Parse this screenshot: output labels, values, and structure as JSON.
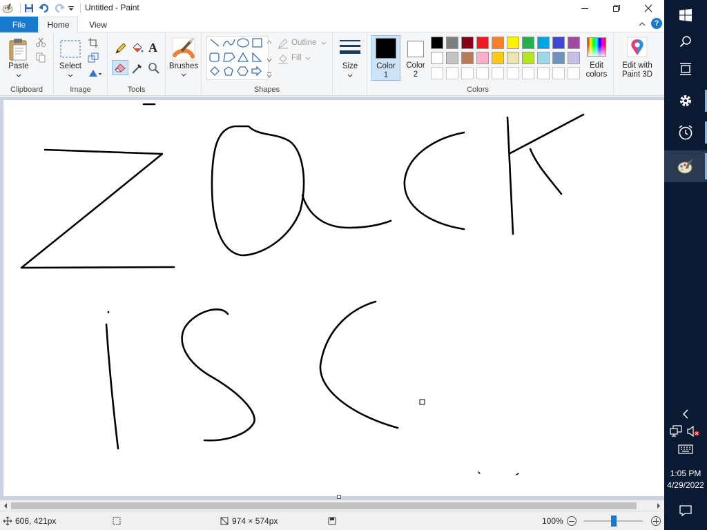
{
  "window": {
    "title": "Untitled - Paint",
    "minimize_icon": "minimize-icon",
    "restore_icon": "restore-icon",
    "close_icon": "close-icon"
  },
  "tabs": {
    "file": "File",
    "home": "Home",
    "view": "View"
  },
  "ribbon": {
    "clipboard": {
      "label": "Clipboard",
      "paste": "Paste"
    },
    "image": {
      "label": "Image",
      "select": "Select"
    },
    "tools": {
      "label": "Tools"
    },
    "brushes": {
      "label": "Brushes"
    },
    "shapes": {
      "label": "Shapes",
      "outline": "Outline",
      "fill": "Fill"
    },
    "size": {
      "label": "Size"
    },
    "color1": {
      "label_line1": "Color",
      "label_line2": "1",
      "value": "#000000"
    },
    "color2": {
      "label_line1": "Color",
      "label_line2": "2",
      "value": "#ffffff"
    },
    "colors": {
      "label": "Colors",
      "palette_row1": [
        "#000000",
        "#7f7f7f",
        "#880015",
        "#ed1c24",
        "#ff7f27",
        "#fff200",
        "#22b14c",
        "#00a2e8",
        "#3f48cc",
        "#a349a4"
      ],
      "palette_row2": [
        "#ffffff",
        "#c3c3c3",
        "#b97a57",
        "#ffaec9",
        "#ffc90e",
        "#efe4b0",
        "#b5e61d",
        "#99d9ea",
        "#7092be",
        "#c8bfe7"
      ],
      "palette_row3": [
        "#ffffff",
        "#ffffff",
        "#ffffff",
        "#ffffff",
        "#ffffff",
        "#ffffff",
        "#ffffff",
        "#ffffff",
        "#ffffff",
        "#ffffff"
      ]
    },
    "edit_colors": {
      "line1": "Edit",
      "line2": "colors"
    },
    "paint3d": {
      "line1": "Edit with",
      "line2": "Paint 3D"
    }
  },
  "canvas": {
    "drawn_text": "ZOCK IS C",
    "stroke_color": "#000000"
  },
  "status": {
    "cursor_position": "606, 421px",
    "image_size": "974 × 574px",
    "zoom": "100%"
  },
  "taskbar": {
    "time": "1:05 PM",
    "date": "4/29/2022"
  }
}
